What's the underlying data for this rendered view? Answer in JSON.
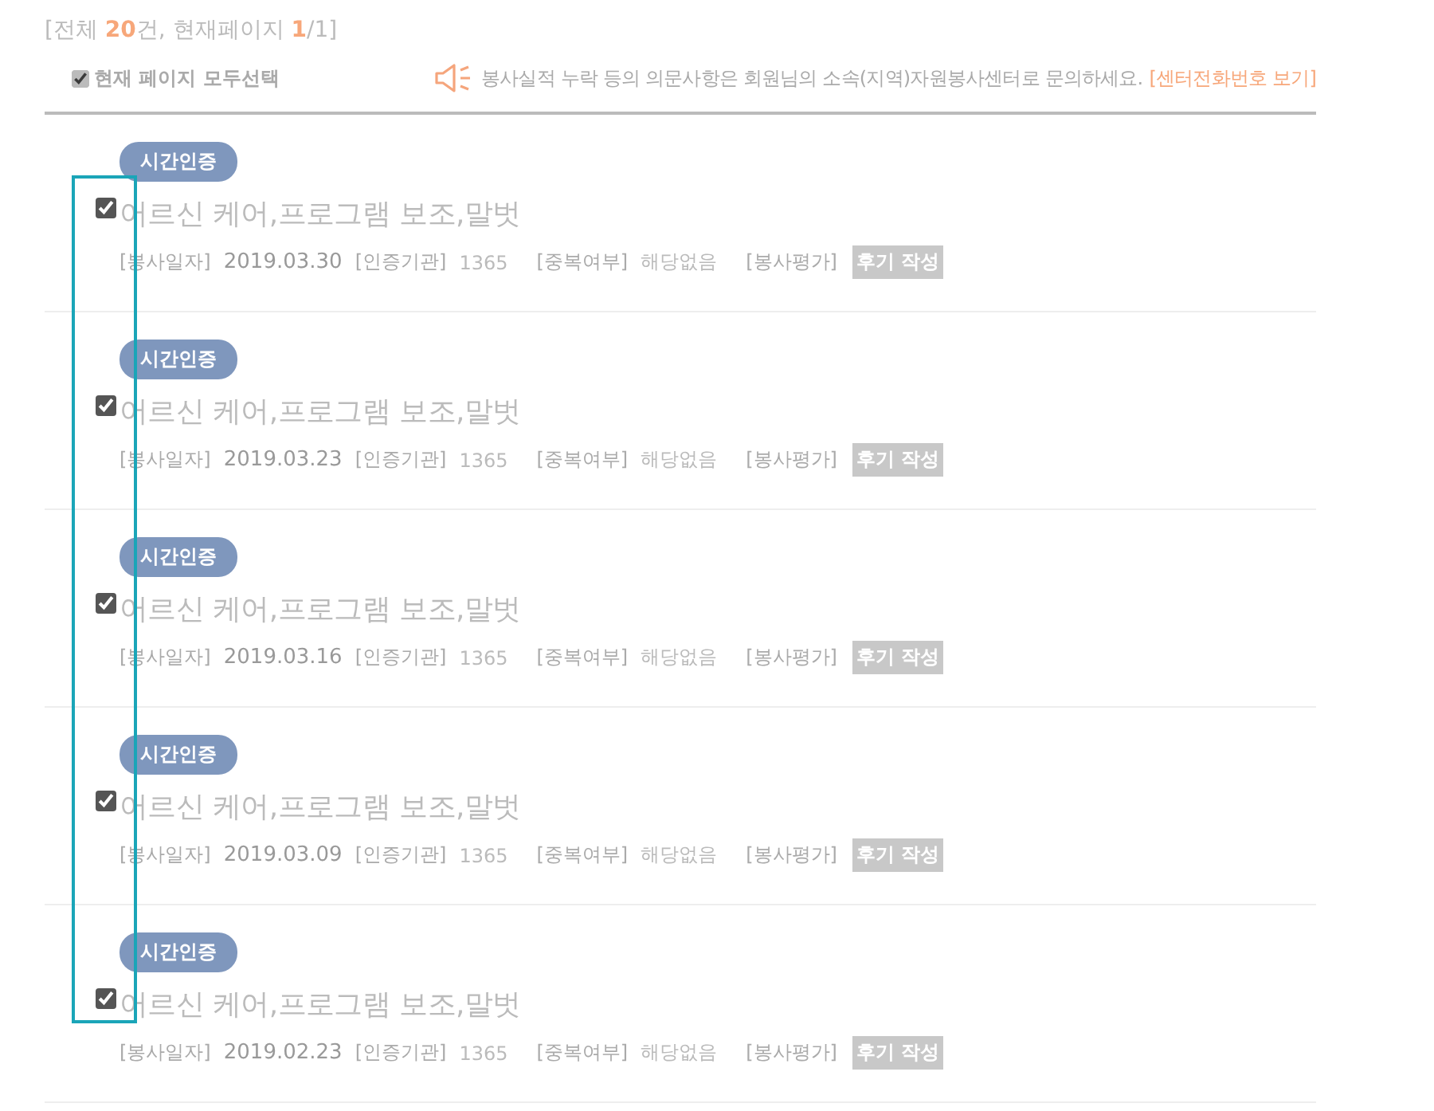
{
  "summary": {
    "prefix": "[전체 ",
    "total": "20",
    "middle": "건, 현재페이지 ",
    "current_page": "1",
    "suffix": "/1]"
  },
  "select_all": {
    "label": "현재 페이지 모두선택",
    "checked": true
  },
  "notice": {
    "text": "봉사실적 누락 등의 의문사항은 회원님의 소속(지역)자원봉사센터로 문의하세요.",
    "link": "[센터전화번호 보기]"
  },
  "records": [
    {
      "badge": "시간인증",
      "checked": true,
      "title": "어르신 케어,프로그램 보조,말벗",
      "fields": [
        {
          "label": "[봉사일자]",
          "value": "2019.03.30"
        },
        {
          "label": "[인증기관]",
          "value": "1365"
        },
        {
          "label": "[중복여부]",
          "value": "해당없음"
        },
        {
          "label": "[봉사평가]"
        }
      ],
      "review_button": "후기 작성"
    },
    {
      "badge": "시간인증",
      "checked": true,
      "title": "어르신 케어,프로그램 보조,말벗",
      "fields": [
        {
          "label": "[봉사일자]",
          "value": "2019.03.23"
        },
        {
          "label": "[인증기관]",
          "value": "1365"
        },
        {
          "label": "[중복여부]",
          "value": "해당없음"
        },
        {
          "label": "[봉사평가]"
        }
      ],
      "review_button": "후기 작성"
    },
    {
      "badge": "시간인증",
      "checked": true,
      "title": "어르신 케어,프로그램 보조,말벗",
      "fields": [
        {
          "label": "[봉사일자]",
          "value": "2019.03.16"
        },
        {
          "label": "[인증기관]",
          "value": "1365"
        },
        {
          "label": "[중복여부]",
          "value": "해당없음"
        },
        {
          "label": "[봉사평가]"
        }
      ],
      "review_button": "후기 작성"
    },
    {
      "badge": "시간인증",
      "checked": true,
      "title": "어르신 케어,프로그램 보조,말벗",
      "fields": [
        {
          "label": "[봉사일자]",
          "value": "2019.03.09"
        },
        {
          "label": "[인증기관]",
          "value": "1365"
        },
        {
          "label": "[중복여부]",
          "value": "해당없음"
        },
        {
          "label": "[봉사평가]"
        }
      ],
      "review_button": "후기 작성"
    },
    {
      "badge": "시간인증",
      "checked": true,
      "title": "어르신 케어,프로그램 보조,말벗",
      "fields": [
        {
          "label": "[봉사일자]",
          "value": "2019.02.23"
        },
        {
          "label": "[인증기관]",
          "value": "1365"
        },
        {
          "label": "[중복여부]",
          "value": "해당없음"
        },
        {
          "label": "[봉사평가]"
        }
      ],
      "review_button": "후기 작성"
    }
  ]
}
